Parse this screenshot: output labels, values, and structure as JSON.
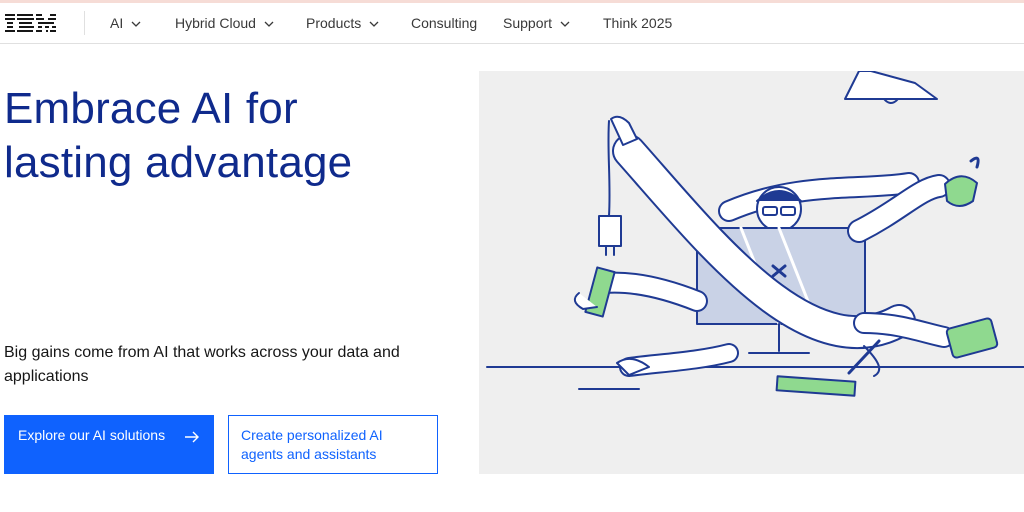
{
  "brand": {
    "logo_text": "IBM"
  },
  "nav": {
    "items": [
      {
        "label": "AI",
        "has_dropdown": true
      },
      {
        "label": "Hybrid Cloud",
        "has_dropdown": true
      },
      {
        "label": "Products",
        "has_dropdown": true
      },
      {
        "label": "Consulting",
        "has_dropdown": false
      },
      {
        "label": "Support",
        "has_dropdown": true
      },
      {
        "label": "Think 2025",
        "has_dropdown": false
      }
    ]
  },
  "hero": {
    "headline_line1": "Embrace AI for",
    "headline_line2": "lasting advantage",
    "subtext": "Big gains come from AI that works across your data and applications",
    "primary_cta": {
      "label": "Explore our AI solutions",
      "icon": "arrow-right-icon"
    },
    "secondary_cta": {
      "label": "Create personalized AI agents and assistants"
    }
  },
  "colors": {
    "accent": "#0f62fe",
    "headline": "#0f2a8c",
    "illustration_bg": "#efefef",
    "illustration_line": "#1f3a93",
    "illustration_green": "#8fd98f"
  }
}
